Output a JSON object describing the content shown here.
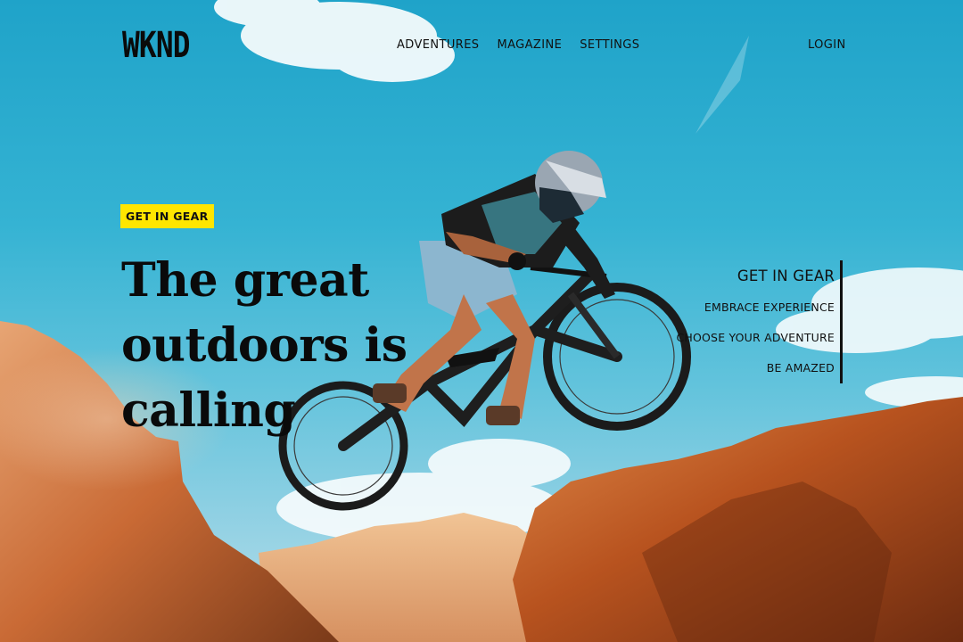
{
  "header": {
    "logo": "WKND",
    "nav": [
      "ADVENTURES",
      "MAGAZINE",
      "SETTINGS"
    ],
    "login": "LOGIN"
  },
  "hero": {
    "tag": "GET IN GEAR",
    "headline": "The great outdoors is calling"
  },
  "side_nav": {
    "items": [
      "GET IN GEAR",
      "EMBRACE EXPERIENCE",
      "CHOOSE YOUR ADVENTURE",
      "BE AMAZED"
    ],
    "active": "GET IN GEAR"
  },
  "colors": {
    "tag_bg": "#ffe600",
    "sky": "#2aaed0",
    "rock": "#c56a2e"
  }
}
